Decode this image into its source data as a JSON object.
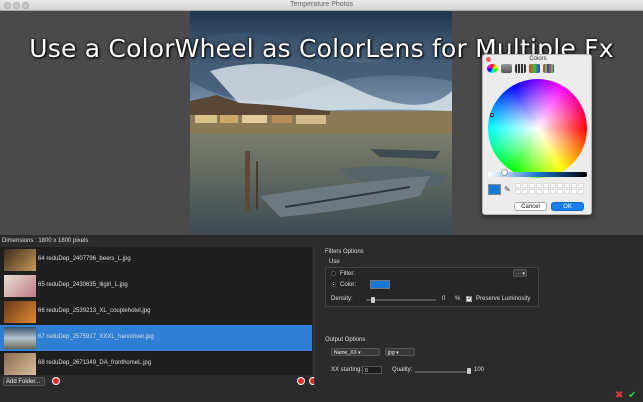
{
  "window": {
    "title": "Temperature Photos"
  },
  "headline": "Use a ColorWheel as ColorLens for Multiple Fx",
  "colors_panel": {
    "title": "Colors",
    "cancel_label": "Cancel",
    "ok_label": "OK",
    "selected_color": "#1a78d6"
  },
  "image_info": {
    "dimensions": "Dimensions : 1800 x 1800 pixels"
  },
  "file_list": {
    "items": [
      {
        "name": "64 reduDep_2407796_beers_L.jpg",
        "selected": false
      },
      {
        "name": "65 reduDep_2430635_lilgirl_L.jpg",
        "selected": false
      },
      {
        "name": "66 reduDep_2539213_XL_couplehotel.jpg",
        "selected": false
      },
      {
        "name": "67 reduDep_2575917_XXXL_hanoiriver.jpg",
        "selected": true
      },
      {
        "name": "68 reduDep_2671349_DA_fronthomeL.jpg",
        "selected": false
      }
    ],
    "add_folder_label": "Add Folder..."
  },
  "filter_options": {
    "title": "Filters Options",
    "use_label": "Use",
    "filter_label": "Filter:",
    "color_label": "Color:",
    "color_value": "#1a78d6",
    "density_label": "Density:",
    "density_value": "0",
    "density_unit": "%",
    "preserve_luminosity_label": "Preserve Luminosity",
    "preserve_luminosity_checked": true
  },
  "output_options": {
    "title": "Output Options",
    "name_format": "Name_XX",
    "file_type": "jpg",
    "xx_starting_label": "XX starting:",
    "xx_starting_value": "0",
    "quality_label": "Quality:",
    "quality_value": "100"
  }
}
